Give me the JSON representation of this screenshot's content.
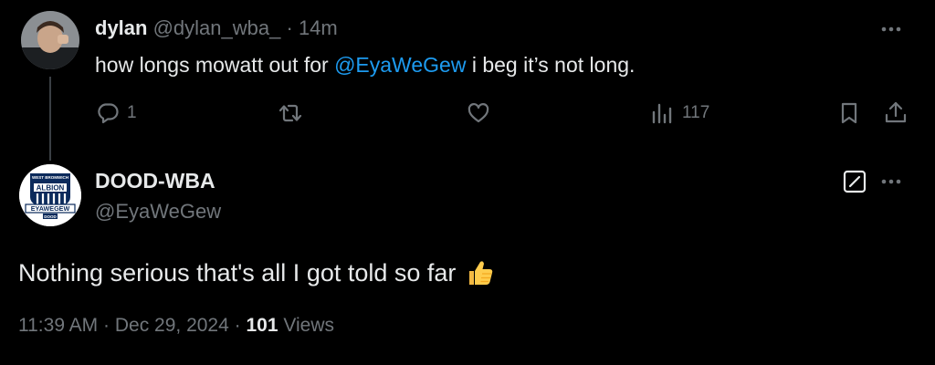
{
  "parent_tweet": {
    "display_name": "dylan",
    "handle": "@dylan_wba_",
    "separator": "·",
    "time_ago": "14m",
    "text_before": "how longs mowatt out for ",
    "mention": "@EyaWeGew",
    "text_after": " i beg it’s not long.",
    "reply_count": "1",
    "retweet_count": "",
    "like_count": "",
    "view_count": "117"
  },
  "reply_tweet": {
    "display_name": "DOOD-WBA",
    "handle": "@EyaWeGew",
    "text": "Nothing serious that's all I got told so far",
    "emoji_icon": "thumbs-up-icon",
    "timestamp": "11:39 AM",
    "date": "Dec 29, 2024",
    "separator": "·",
    "views_count": "101",
    "views_label": "Views"
  },
  "avatar_logo": {
    "top_text": "WEST BROMWICH",
    "club_text": "ALBION",
    "banner_text": "EYAWEGEW",
    "bottom_text": "DOOD"
  },
  "colors": {
    "background": "#000000",
    "text_primary": "#e7e9ea",
    "text_secondary": "#71767b",
    "accent_link": "#1d9bf0",
    "thread_line": "#3a3f44"
  }
}
